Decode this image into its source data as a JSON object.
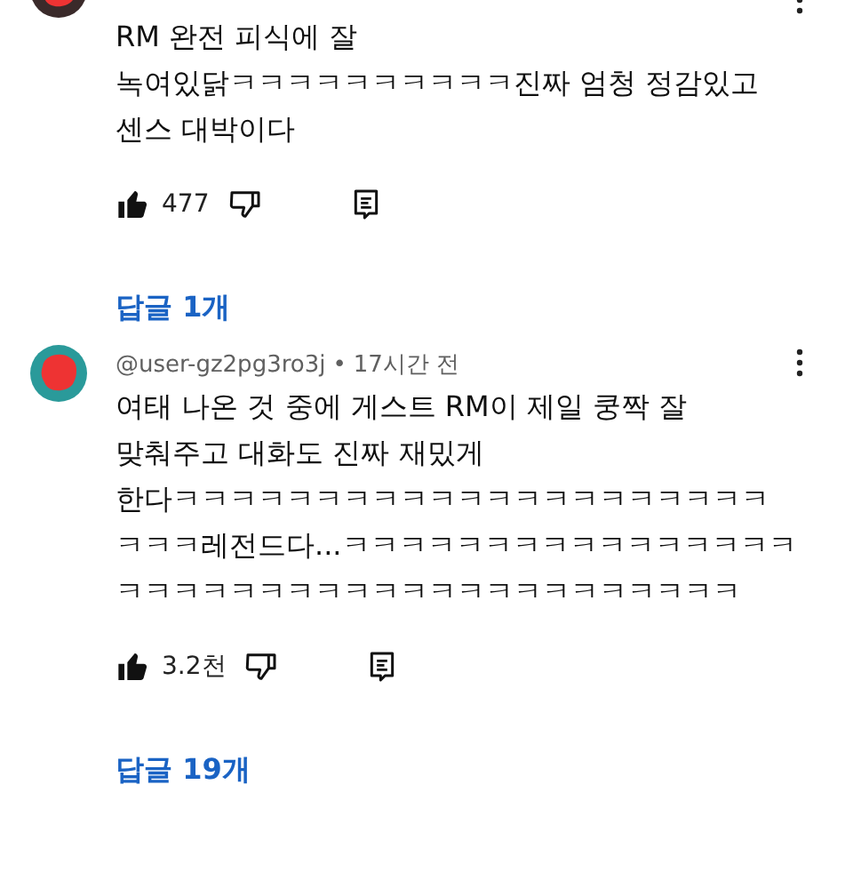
{
  "comments": [
    {
      "lines": [
        "RM 완전 피식에 잘",
        "녹여있닭ㅋㅋㅋㅋㅋㅋㅋㅋㅋㅋ진짜 엄청 정감있고",
        "센스 대박이다"
      ],
      "likes": "477",
      "replies": "답글 1개"
    },
    {
      "author": "@user-gz2pg3ro3j",
      "separator": "•",
      "time": "17시간 전",
      "lines": [
        "여태 나온 것 중에 게스트 RM이 제일 쿵짝 잘",
        "맞춰주고 대화도 진짜 재밌게",
        "한다ㅋㅋㅋㅋㅋㅋㅋㅋㅋㅋㅋㅋㅋㅋㅋㅋㅋㅋㅋㅋㅋ",
        "ㅋㅋㅋ레전드다...ㅋㅋㅋㅋㅋㅋㅋㅋㅋㅋㅋㅋㅋㅋㅋㅋ",
        "ㅋㅋㅋㅋㅋㅋㅋㅋㅋㅋㅋㅋㅋㅋㅋㅋㅋㅋㅋㅋㅋㅋ"
      ],
      "likes": "3.2천",
      "replies": "답글 19개"
    }
  ]
}
